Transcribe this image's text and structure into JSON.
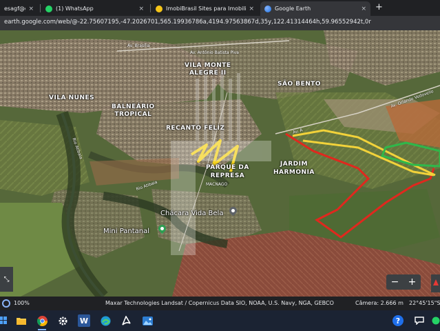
{
  "tabs": [
    {
      "title": "esagf@gmail.com",
      "icon": "gmail-icon",
      "active": false
    },
    {
      "title": "(1) WhatsApp",
      "icon": "whatsapp-icon",
      "active": false
    },
    {
      "title": "ImobiBrasil Sites para Imobiliárias e",
      "icon": "imobibrasil-icon",
      "active": false
    },
    {
      "title": "Google Earth",
      "icon": "google-earth-icon",
      "active": true
    }
  ],
  "tab_close": "×",
  "new_tab": "+",
  "address": {
    "url": "earth.google.com/web/@-22.75607195,-47.2026701,565.19936786a,4194.97563867d,35y,122.41314464h,59.96552942t,0r"
  },
  "map": {
    "places": {
      "vila_monte_alegre": "VILA MONTE\nALEGRE II",
      "sao_bento": "SÃO BENTO",
      "vila_nunes": "VILA NUNES",
      "balneario_tropical": "BALNEÁRIO\nTROPICAL",
      "recanto_feliz": "RECANTO FELIZ",
      "jardim_harmonia": "JARDIM\nHARMONIA",
      "parque_da_represa": "PARQUE DA\nREPRESA",
      "chacara_vida_bela": "Chácara Vida Bela",
      "mini_pantanal": "Mini Pantanal"
    },
    "roads": {
      "av_brasilia": "Av. Brasília",
      "av_antonio": "Av. Antônio Batista Piva",
      "av_orlando": "Av. Orlando Vedovello",
      "av_a": "Av. A",
      "rio_atibaia_1": "Rio Atibaia",
      "rio_atibaia_2": "Rio Atibaia",
      "macnago": "MACNAGO"
    },
    "overlay_colors": {
      "red": "#e0281e",
      "yellow": "#f2d23a",
      "green": "#2fb84a"
    },
    "zoom_minus": "−",
    "zoom_plus": "+"
  },
  "status": {
    "zoom": "100%",
    "attribution": "Maxar Technologies   Landsat / Copernicus   Data SIO, NOAA, U.S. Navy, NGA, GEBCO",
    "camera": "Câmera: 2.666 m",
    "coords": "22°45'15\"S"
  },
  "taskbar": {
    "items": [
      "windows-icon",
      "file-explorer-icon",
      "chrome-icon",
      "settings-icon",
      "word-icon",
      "edge-icon",
      "acrobat-icon",
      "photos-icon"
    ],
    "word_letter": "W"
  }
}
